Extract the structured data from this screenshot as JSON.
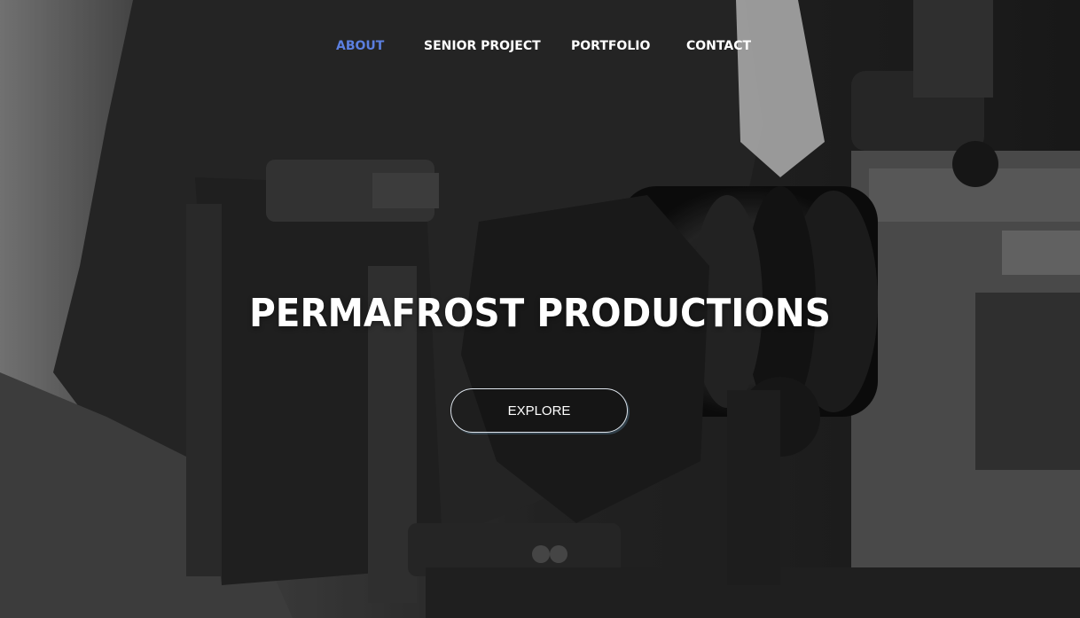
{
  "nav": {
    "items": [
      {
        "label": "ABOUT",
        "active": true
      },
      {
        "label": "SENIOR PROJECT",
        "active": false
      },
      {
        "label": "PORTFOLIO",
        "active": false
      },
      {
        "label": "CONTACT",
        "active": false
      }
    ]
  },
  "hero": {
    "title": "PERMAFROST PRODUCTIONS",
    "cta_label": "EXPLORE"
  },
  "colors": {
    "active_nav": "#5b7fe0",
    "text": "#ffffff"
  }
}
